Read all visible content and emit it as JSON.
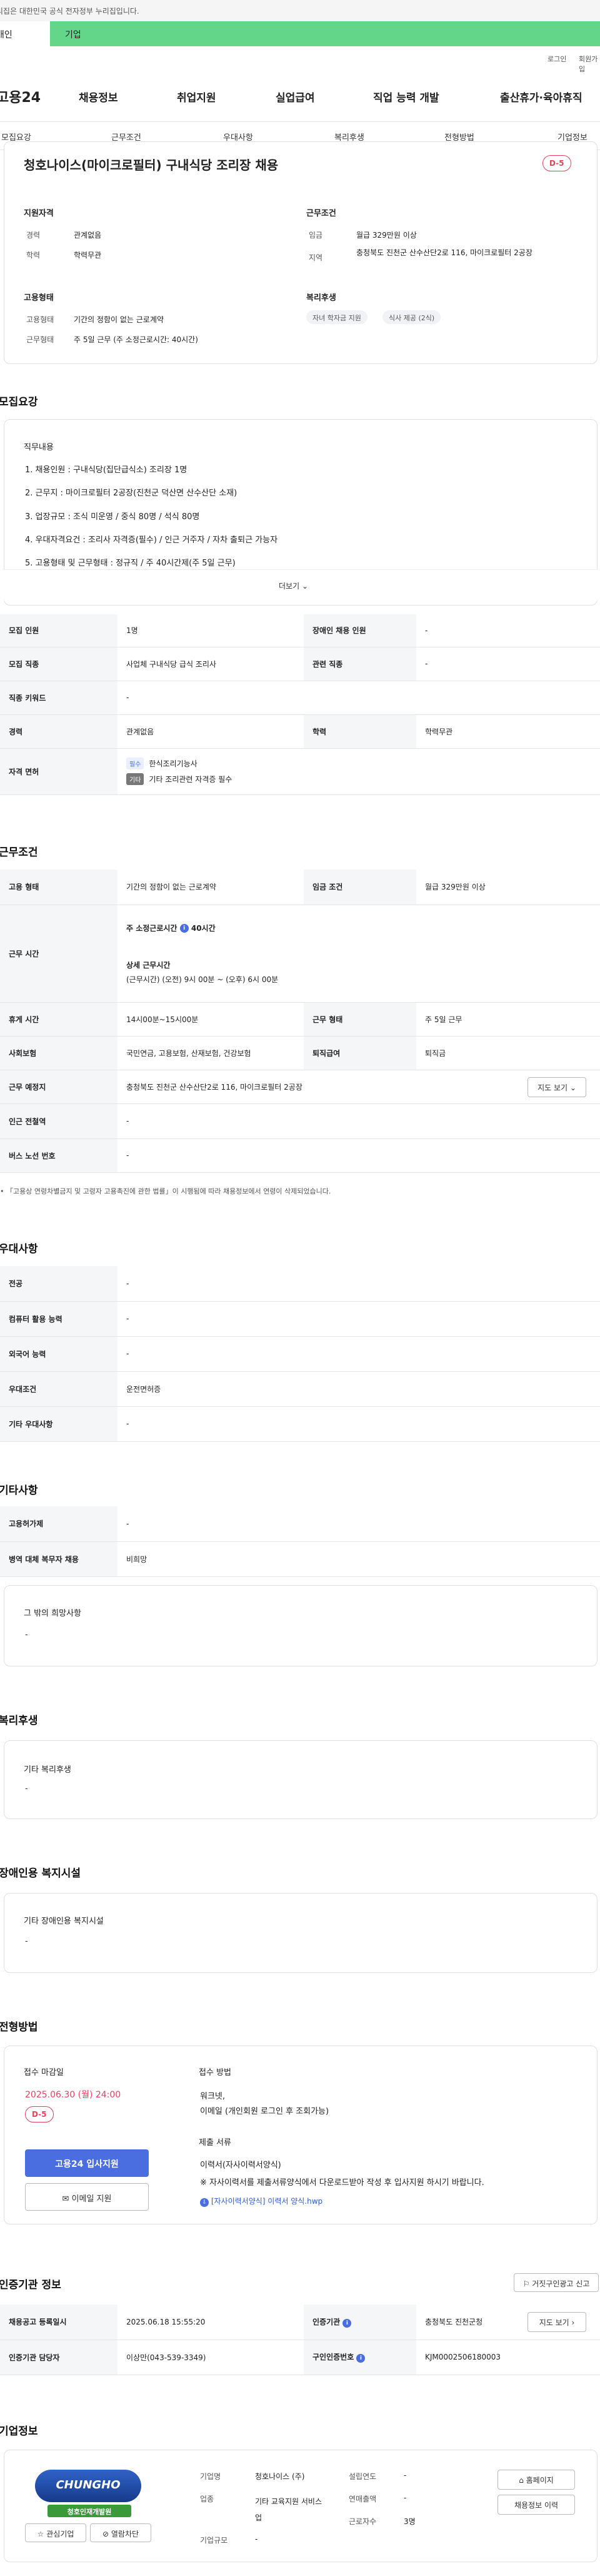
{
  "gov_banner": "이 누리집은 대한민국 공식 전자정부 누리집입니다.",
  "topbar": {
    "tab1": "개인",
    "tab2": "기업"
  },
  "util": {
    "login": "로그인",
    "join": "회원가입"
  },
  "logo": "고용24",
  "gnb": [
    "채용정보",
    "취업지원",
    "실업급여",
    "직업 능력 개발",
    "출산휴가·육아휴직"
  ],
  "tabs": [
    "모집요강",
    "근무조건",
    "우대사항",
    "복리후생",
    "전형방법",
    "기업정보"
  ],
  "job": {
    "title": "청호나이스(마이크로필터) 구내식당 조리장 채용",
    "dday": "D-5",
    "qual_title": "지원자격",
    "career_label": "경력",
    "career_value": "관계없음",
    "edu_label": "학력",
    "edu_value": "학력무관",
    "cond_title": "근무조건",
    "wage_label": "임금",
    "wage_value": "월급 329만원 이상",
    "region_label": "지역",
    "region_value": "충청북도 진천군 산수산단2로 116, 마이크로필터 2공장",
    "emp_title": "고용형태",
    "emptype_label": "고용형태",
    "emptype_value": "기간의 정함이 없는 근로계약",
    "worktype_label": "근무형태",
    "worktype_value": "주 5일 근무 (주 소정근로시간: 40시간)",
    "welfare_title": "복리후생",
    "welfare_chips": [
      "자녀 학자금 지원",
      "식사 제공 (2식)"
    ]
  },
  "recruit": {
    "section_title": "모집요강",
    "duty_title": "직무내용",
    "duties": [
      "1. 채용인원 : 구내식당(집단급식소) 조리장 1명",
      "2. 근무지 : 마이크로필터 2공장(진천군 덕산면 산수산단 소재)",
      "3. 업장규모 : 조식 미운영 / 중식 80명 / 석식 80명",
      "4. 우대자격요건 : 조리사 자격증(필수) / 인근 거주자 / 자차 출퇴근 가능자",
      "5. 고용형태 및 근무형태 : 정규직 / 주 40시간제(주 5일 근무)"
    ],
    "more": "더보기",
    "rows": [
      [
        "모집 인원",
        "1명",
        "장애인 채용 인원",
        "-"
      ],
      [
        "모집 직종",
        "사업체 구내식당 급식 조리사",
        "관련 직종",
        "-"
      ],
      [
        "직종 키워드",
        "-"
      ],
      [
        "경력",
        "관계없음",
        "학력",
        "학력무관"
      ]
    ],
    "license_label": "자격 면허",
    "license_items": [
      {
        "tag": "필수",
        "text": "한식조리기능사"
      },
      {
        "tag": "기타",
        "text": "기타 조리관련 자격증 필수"
      }
    ]
  },
  "work": {
    "section_title": "근무조건",
    "emp_label": "고용 형태",
    "emp_value": "기간의 정함이 없는 근로계약",
    "wage_label": "임금 조건",
    "wage_value": "월급 329만원 이상",
    "hours_label": "근무 시간",
    "weekly_hours": "주 소정근로시간",
    "weekly_hours_value": "40시간",
    "detail_title": "상세 근무시간",
    "detail_value": "(근무시간) (오전) 9시 00분 ~ (오후) 6시 00분",
    "rows": [
      [
        "휴게 시간",
        "14시00분~15시00분",
        "근무 형태",
        "주 5일 근무"
      ],
      [
        "사회보험",
        "국민연금, 고용보험, 산재보험, 건강보험",
        "퇴직급여",
        "퇴직금"
      ]
    ],
    "place_label": "근무 예정지",
    "place_value": "충청북도 진천군 산수산단2로 116, 마이크로필터 2공장",
    "map_btn": "지도 보기",
    "station_label": "인근 전철역",
    "station_value": "-",
    "bus_label": "버스 노선 번호",
    "bus_value": "-",
    "note": "「고용상 연령차별금지 및 고령자 고용촉진에 관한 법률」이 시행됨에 따라 채용정보에서 연령이 삭제되었습니다."
  },
  "pref": {
    "section_title": "우대사항",
    "rows": [
      [
        "전공",
        "-"
      ],
      [
        "컴퓨터 활용 능력",
        "-"
      ],
      [
        "외국어 능력",
        "-"
      ],
      [
        "우대조건",
        "운전면허증"
      ],
      [
        "기타 우대사항",
        "-"
      ]
    ]
  },
  "etc": {
    "section_title": "기타사항",
    "rows": [
      [
        "고용허가제",
        "-"
      ],
      [
        "병역 대체 복무자 채용",
        "비희망"
      ]
    ],
    "wish_title": "그 밖의 희망사항",
    "wish_value": "-"
  },
  "welfare": {
    "section_title": "복리후생",
    "card_title": "기타 복리후생",
    "card_value": "-"
  },
  "disability": {
    "section_title": "장애인용 복지시설",
    "card_title": "기타 장애인용 복지시설",
    "card_value": "-"
  },
  "apply": {
    "section_title": "전형방법",
    "deadline_label": "접수 마감일",
    "deadline": "2025.06.30 (월) 24:00",
    "dday": "D-5",
    "apply_btn": "고용24 입사지원",
    "email_btn": "이메일 지원",
    "method_label": "접수 방법",
    "method_1": "워크넷,",
    "method_2": "이메일 (개인회원 로그인 후 조회가능)",
    "docs_label": "제출 서류",
    "docs_1": "이력서(자사이력서양식)",
    "docs_2": "※ 자사이력서를 제출서류양식에서 다운로드받아 작성 후 입사지원 하시기 바랍니다.",
    "docs_link": "[자사이력서양식] 이력서 양식.hwp"
  },
  "cert": {
    "section_title": "인증기관 정보",
    "top_btn": "거짓구인광고 신고",
    "reg_label": "채용공고 등록일시",
    "reg_value": "2025.06.18 15:55:20",
    "org_label": "인증기관",
    "org_value": "충청북도 진천군청",
    "map_btn": "지도 보기",
    "mgr_label": "인증기관 담당자",
    "mgr_value": "이상만(043-539-3349)",
    "no_label": "구인인증번호",
    "no_value": "KJM0002506180003"
  },
  "company": {
    "section_title": "기업정보",
    "logo_text": "CHUNGHO",
    "logo_sub": "청호인재개발원",
    "fav_btn": "관심기업",
    "block_btn": "열람차단",
    "name_label": "기업명",
    "name_value": "청호나이스 (주)",
    "industry_label": "업종",
    "industry_value": "기타 교육지원 서비스업",
    "scale_label": "기업규모",
    "scale_value": "-",
    "founded_label": "설립연도",
    "founded_value": "-",
    "sales_label": "연매출액",
    "sales_value": "-",
    "staff_label": "근로자수",
    "staff_value": "3명",
    "homepage_btn": "홈페이지",
    "more_jobs_btn": "채용정보 이력"
  }
}
